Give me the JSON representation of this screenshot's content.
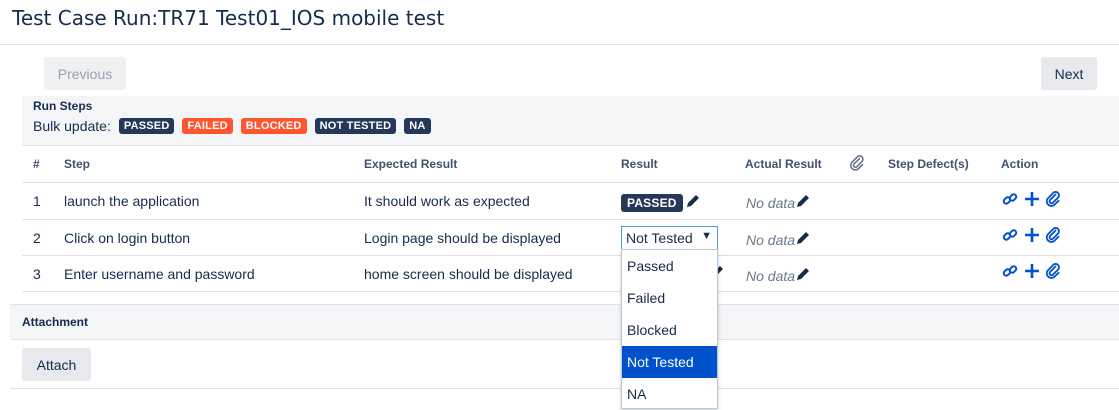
{
  "page": {
    "title": "Test Case Run:TR71 Test01_IOS mobile test"
  },
  "nav": {
    "previous_label": "Previous",
    "next_label": "Next"
  },
  "run_steps": {
    "section_label": "Run Steps",
    "bulk_label": "Bulk update:",
    "bulk_options": [
      "PASSED",
      "FAILED",
      "BLOCKED",
      "NOT TESTED",
      "NA"
    ],
    "columns": {
      "num": "#",
      "step": "Step",
      "expected": "Expected Result",
      "result": "Result",
      "actual": "Actual Result",
      "defects": "Step Defect(s)",
      "action": "Action"
    },
    "rows": [
      {
        "num": "1",
        "step": "launch the application",
        "expected": "It should work as expected",
        "result": "PASSED",
        "actual": "No data"
      },
      {
        "num": "2",
        "step": "Click on login button",
        "expected": "Login page should be displayed",
        "result": "Not Tested",
        "actual": "No data"
      },
      {
        "num": "3",
        "step": "Enter username and password",
        "expected": "home screen should be displayed",
        "result": "",
        "actual": "No data"
      }
    ]
  },
  "result_dropdown": {
    "selected": "Not Tested",
    "options": [
      "Passed",
      "Failed",
      "Blocked",
      "Not Tested",
      "NA"
    ]
  },
  "attachment": {
    "section_label": "Attachment",
    "attach_label": "Attach"
  },
  "colors": {
    "dark_lozenge": "#253858",
    "red_lozenge": "#ff5630",
    "link_blue": "#0052cc",
    "select_highlight": "#0052cc"
  }
}
